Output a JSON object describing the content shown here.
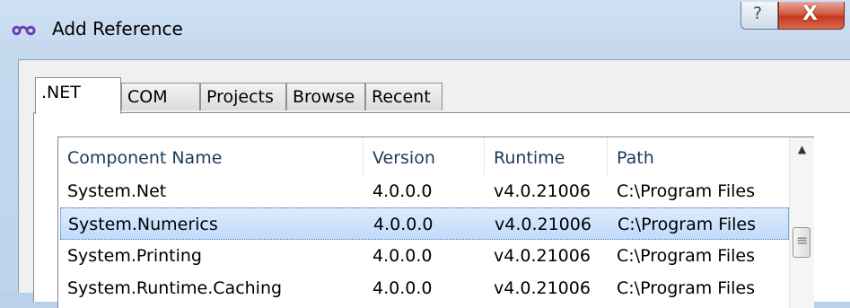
{
  "window": {
    "title": "Add Reference",
    "help_label": "?",
    "close_label": "X"
  },
  "tabs": [
    {
      "label": ".NET",
      "active": true
    },
    {
      "label": "COM",
      "active": false
    },
    {
      "label": "Projects",
      "active": false
    },
    {
      "label": "Browse",
      "active": false
    },
    {
      "label": "Recent",
      "active": false
    }
  ],
  "list": {
    "columns": [
      "Component Name",
      "Version",
      "Runtime",
      "Path"
    ],
    "rows": [
      {
        "name": "System.Net",
        "version": "4.0.0.0",
        "runtime": "v4.0.21006",
        "path": "C:\\Program Files",
        "selected": false
      },
      {
        "name": "System.Numerics",
        "version": "4.0.0.0",
        "runtime": "v4.0.21006",
        "path": "C:\\Program Files",
        "selected": true
      },
      {
        "name": "System.Printing",
        "version": "4.0.0.0",
        "runtime": "v4.0.21006",
        "path": "C:\\Program Files",
        "selected": false
      },
      {
        "name": "System.Runtime.Caching",
        "version": "4.0.0.0",
        "runtime": "v4.0.21006",
        "path": "C:\\Program Files",
        "selected": false
      }
    ]
  },
  "colors": {
    "selection": "#c1dbfc",
    "header_text": "#1e395b",
    "close_button": "#c5391f"
  },
  "icons": {
    "app": "infinity-icon",
    "scroll_up": "scroll-up-arrow-icon",
    "thumb": "scroll-thumb-grip-icon"
  }
}
